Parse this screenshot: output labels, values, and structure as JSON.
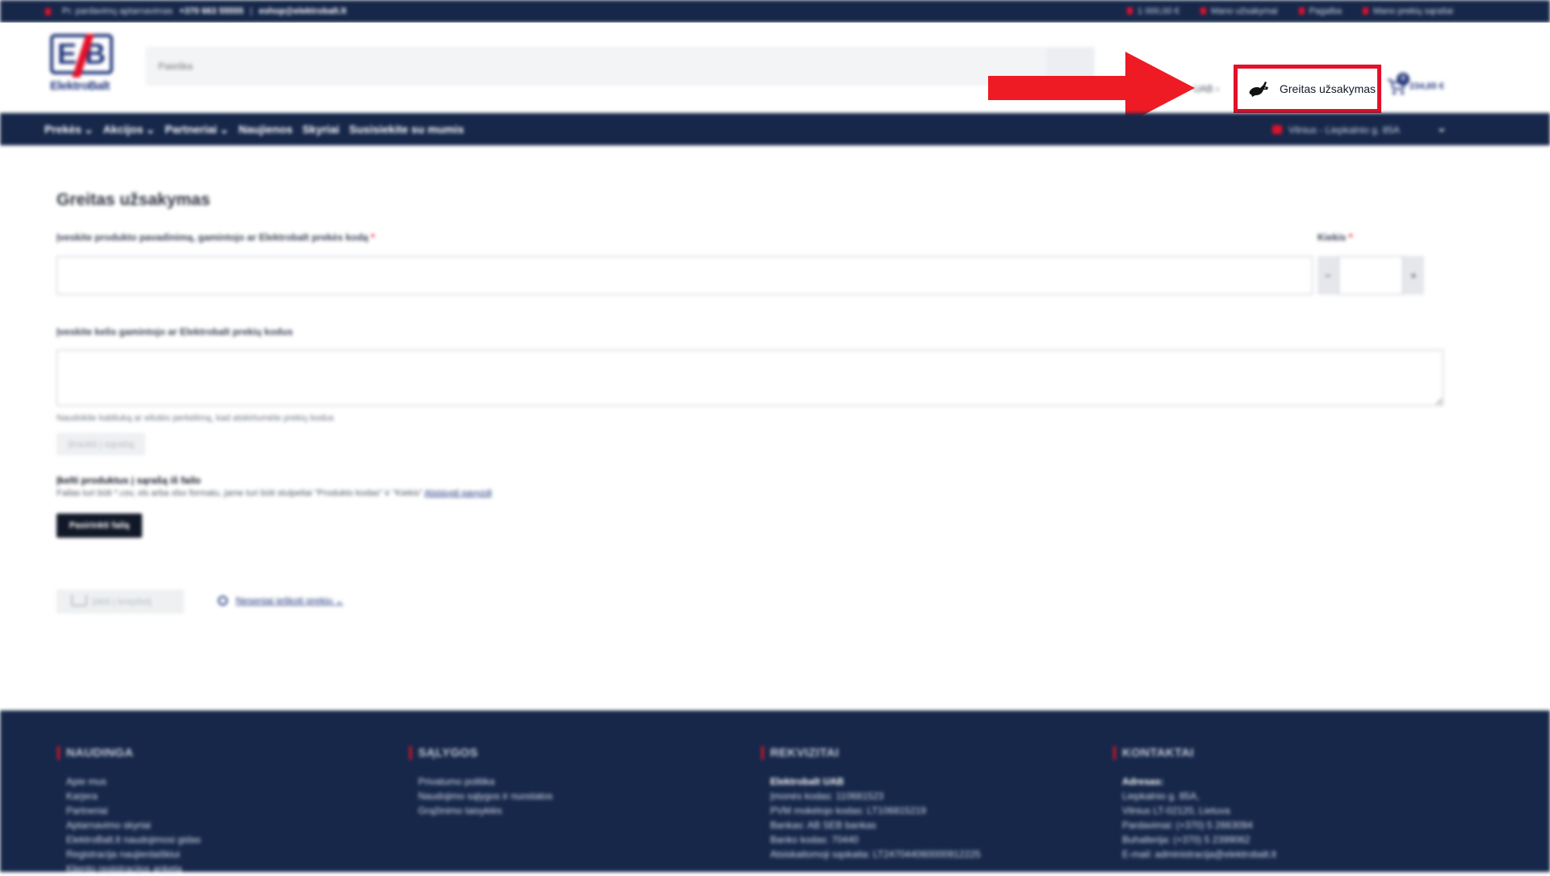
{
  "topbar": {
    "phone_label": "Pr. pardavimų aptarnavimas",
    "phone": "+370 663 55555",
    "email": "eshop@elektrobalt.lt",
    "links": [
      "1 000,00 €",
      "Mano užsakymai",
      "Pagalba",
      "Mano prekių sąrašai"
    ]
  },
  "header": {
    "logo_text": "ElektroBalt",
    "search_placeholder": "Paieška",
    "company": "UAB",
    "quick_order_label": "Greitas užsakymas",
    "cart_count": "0",
    "cart_total": "234,65 €"
  },
  "nav": {
    "items": [
      "Prekės",
      "Akcijos",
      "Partneriai",
      "Naujienos",
      "Skyriai",
      "Susisiekite su mumis"
    ],
    "store": "Vilnius - Liepkalnio g. 85A"
  },
  "main": {
    "title": "Greitas užsakymas",
    "product_label": "Įveskite produkto pavadinimą, gamintojo ar Elektrobalt prekės kodą",
    "qty_label": "Kiekis",
    "qty_minus": "−",
    "qty_plus": "+",
    "codes_label": "Įveskite kelis gamintojo ar Elektrobalt prekių kodus",
    "hint": "Naudokite kabliuką ar eilutės perkėlimą, kad atskirtumėte prekių kodus",
    "add_codes_button": "Įtraukti į sąrašą",
    "file_title": "Įkelti produktus į sąrašą iš failo",
    "file_desc": "Failas turi būti *.csv, xls arba xlsx formatu, jame turi būti stulpeliai \"Produkto kodas\" ir \"Kiekis\"",
    "file_link": "Atsisiųsti pavyzdį",
    "upload_button": "Pasirinkti failą",
    "add_to_cart": "Įdėti į krepšelį",
    "history_link": "Neseniai ieškoti prekių"
  },
  "footer": {
    "cols": [
      {
        "title": "NAUDINGA",
        "items": [
          "Apie mus",
          "Karjera",
          "Partneriai",
          "Aptarnavimo skyriai",
          "ElektroBalt.lt naudojimosi gidas",
          "Registracija naujienlaiškiui",
          "Kliento registracijos anketa"
        ]
      },
      {
        "title": "SĄLYGOS",
        "items": [
          "Privatumo politika",
          "Naudojimo sąlygos ir nuostatos",
          "Grąžinimo taisyklės"
        ]
      },
      {
        "title": "REKVIZITAI",
        "items": [
          "Elektrobalt UAB",
          "Įmonės kodas: 110681523",
          "PVM mokėtojo kodas: LT106815219",
          "Bankas: AB SEB bankas",
          "Banko kodas: 70440",
          "Atsiskaitomoji sąskaita: LT247044060000912225"
        ]
      },
      {
        "title": "KONTAKTAI",
        "items": [
          "Adresas:",
          "Liepkalnio g. 85A,",
          "Vilnius LT-02120, Lietuva",
          "Pardavimai: (+370) 5 2663094",
          "Buhalterija: (+370) 5 2399062",
          "E-mail: administracija@elektrobalt.lt"
        ]
      }
    ]
  },
  "colors": {
    "navy": "#16274a",
    "brand_blue": "#20357a",
    "accent_red": "#e3112a"
  }
}
